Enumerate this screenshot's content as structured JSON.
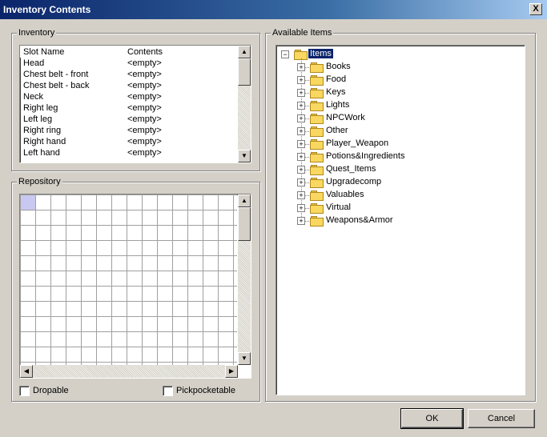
{
  "window": {
    "title": "Inventory Contents",
    "close_glyph": "X"
  },
  "inventory": {
    "legend": "Inventory",
    "columns": [
      "Slot Name",
      "Contents"
    ],
    "rows": [
      {
        "slot": "Head",
        "contents": "<empty>"
      },
      {
        "slot": "Chest belt - front",
        "contents": "<empty>"
      },
      {
        "slot": "Chest belt - back",
        "contents": "<empty>"
      },
      {
        "slot": "Neck",
        "contents": "<empty>"
      },
      {
        "slot": "Right leg",
        "contents": "<empty>"
      },
      {
        "slot": "Left leg",
        "contents": "<empty>"
      },
      {
        "slot": "Right ring",
        "contents": "<empty>"
      },
      {
        "slot": "Right hand",
        "contents": "<empty>"
      },
      {
        "slot": "Left hand",
        "contents": "<empty>"
      }
    ]
  },
  "repository": {
    "legend": "Repository",
    "dropable_label": "Dropable",
    "pickpocketable_label": "Pickpocketable"
  },
  "available": {
    "legend": "Available Items",
    "root": "Items",
    "children": [
      "Books",
      "Food",
      "Keys",
      "Lights",
      "NPCWork",
      "Other",
      "Player_Weapon",
      "Potions&Ingredients",
      "Quest_Items",
      "Upgradecomp",
      "Valuables",
      "Virtual",
      "Weapons&Armor"
    ]
  },
  "buttons": {
    "ok": "OK",
    "cancel": "Cancel"
  },
  "icons": {
    "expander": "plus-box-icon",
    "folder": "folder-icon"
  }
}
